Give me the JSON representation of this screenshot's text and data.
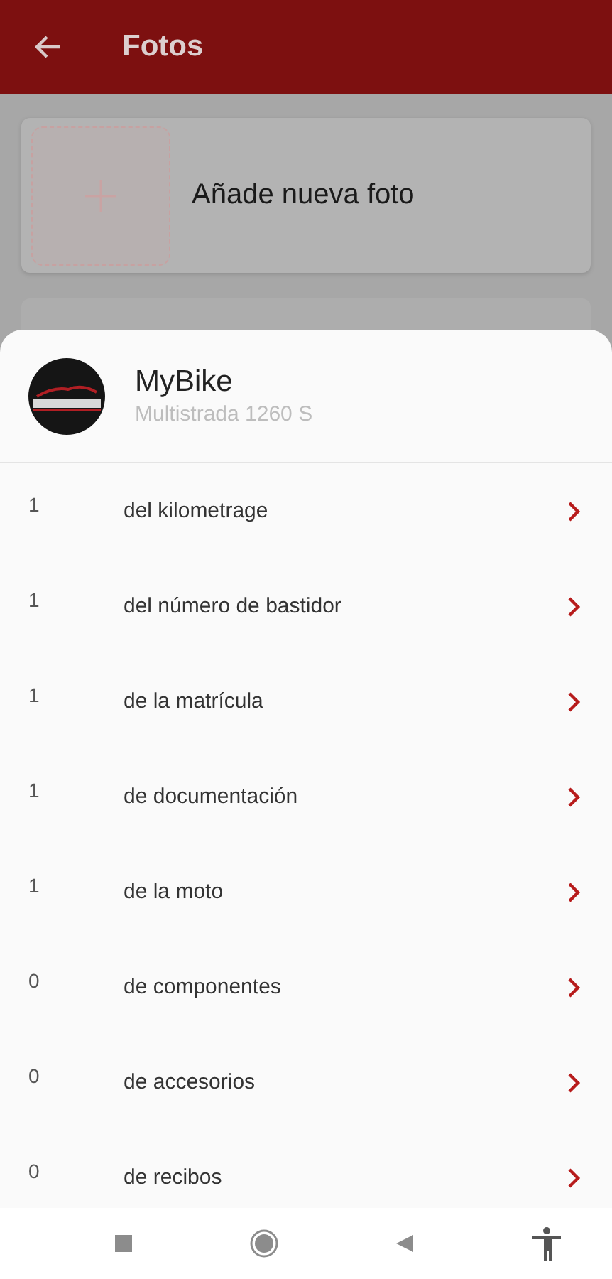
{
  "app_bar": {
    "title": "Fotos"
  },
  "add_photo_card": {
    "label": "Añade nueva foto"
  },
  "sheet": {
    "title": "MyBike",
    "subtitle": "Multistrada 1260 S",
    "items": [
      {
        "count": "1",
        "label": "del kilometrage"
      },
      {
        "count": "1",
        "label": "del número de bastidor"
      },
      {
        "count": "1",
        "label": "de la matrícula"
      },
      {
        "count": "1",
        "label": "de documentación"
      },
      {
        "count": "1",
        "label": "de la moto"
      },
      {
        "count": "0",
        "label": "de componentes"
      },
      {
        "count": "0",
        "label": "de accesorios"
      },
      {
        "count": "0",
        "label": "de recibos"
      }
    ]
  }
}
